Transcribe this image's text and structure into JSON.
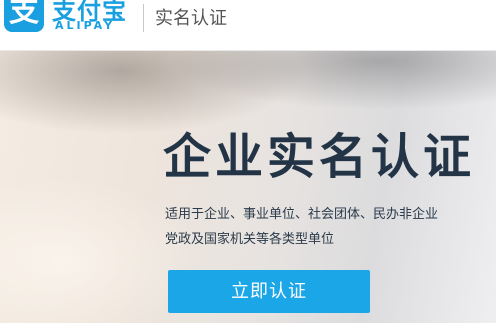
{
  "header": {
    "logo": {
      "mark": "支",
      "cn_name": "支付宝",
      "en_name": "ALIPAY"
    },
    "title": "实名认证"
  },
  "banner": {
    "title": "企业实名认证",
    "description_line1": "适用于企业、事业单位、社会团体、民办非企业",
    "description_line2": "党政及国家机关等各类型单位",
    "cta_label": "立即认证"
  },
  "colors": {
    "brand": "#1a9fe0",
    "button": "#1ba6e8",
    "title_text": "#233447"
  }
}
